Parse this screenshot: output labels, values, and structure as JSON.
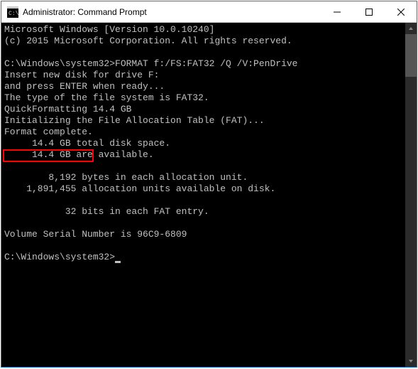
{
  "window": {
    "title": "Administrator: Command Prompt"
  },
  "terminal": {
    "lines": [
      "Microsoft Windows [Version 10.0.10240]",
      "(c) 2015 Microsoft Corporation. All rights reserved.",
      "",
      "C:\\Windows\\system32>FORMAT f:/FS:FAT32 /Q /V:PenDrive",
      "Insert new disk for drive F:",
      "and press ENTER when ready...",
      "The type of the file system is FAT32.",
      "QuickFormatting 14.4 GB",
      "Initializing the File Allocation Table (FAT)...",
      "Format complete.",
      "     14.4 GB total disk space.",
      "     14.4 GB are available.",
      "",
      "        8,192 bytes in each allocation unit.",
      "    1,891,455 allocation units available on disk.",
      "",
      "           32 bits in each FAT entry.",
      "",
      "Volume Serial Number is 96C9-6809",
      "",
      "C:\\Windows\\system32>"
    ],
    "prompt_cursor_line_index": 20
  },
  "highlight": {
    "line_index": 9,
    "text": "Format complete."
  }
}
